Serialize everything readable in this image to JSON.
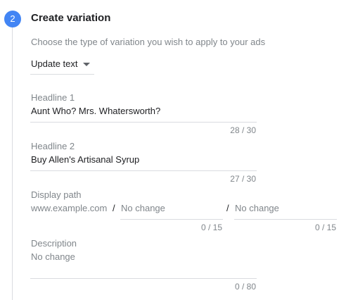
{
  "step": {
    "number": "2",
    "title": "Create variation",
    "subtitle": "Choose the type of variation you wish to apply to your ads",
    "accent_color": "#4285f4"
  },
  "variation_type": {
    "selected": "Update text"
  },
  "headline1": {
    "label": "Headline 1",
    "value": "Aunt Who? Mrs. Whatersworth?",
    "counter": "28 / 30"
  },
  "headline2": {
    "label": "Headline 2",
    "value": "Buy Allen's Artisanal Syrup",
    "counter": "27 / 30"
  },
  "display_path": {
    "label": "Display path",
    "base_url": "www.example.com",
    "separator": "/",
    "path1_placeholder": "No change",
    "path1_counter": "0 / 15",
    "path2_placeholder": "No change",
    "path2_counter": "0 / 15"
  },
  "description": {
    "label": "Description",
    "placeholder": "No change",
    "counter": "0 / 80"
  }
}
